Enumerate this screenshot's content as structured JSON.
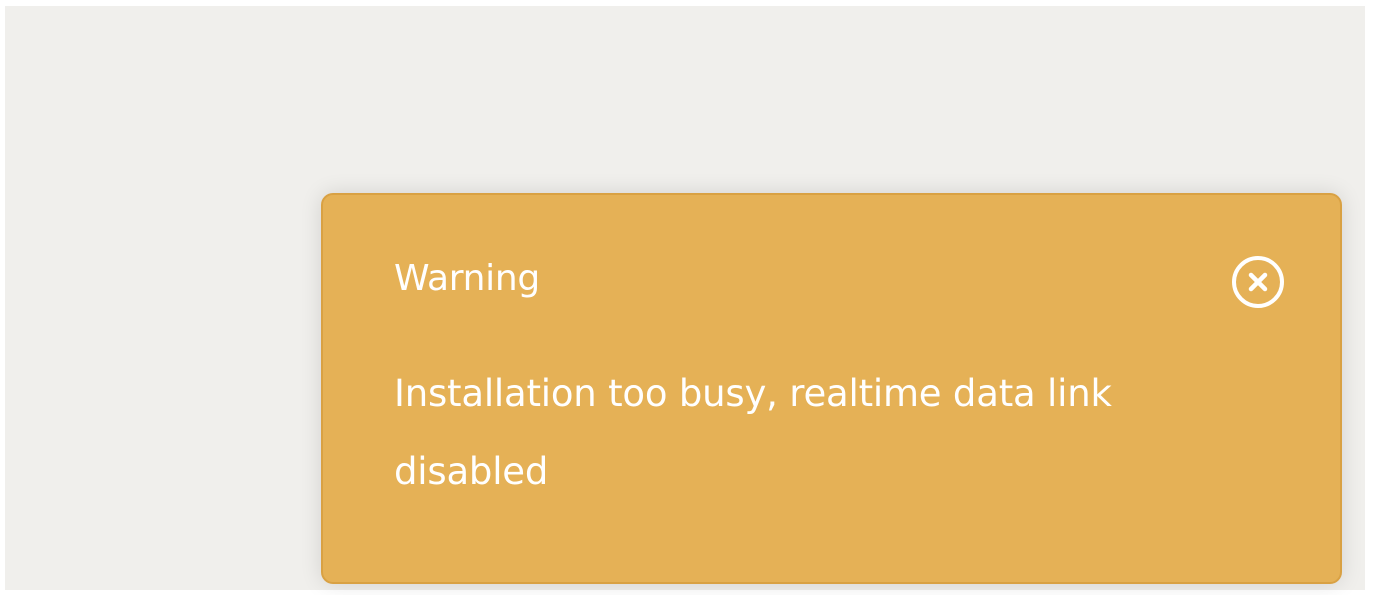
{
  "notification": {
    "type": "warning",
    "title": "Warning",
    "message": "Installation too busy, realtime data link disabled",
    "close_icon": "close-circle-icon",
    "colors": {
      "background": "#e5b156",
      "border": "#d9a143",
      "text": "#ffffff",
      "page_background": "#f0efec"
    }
  }
}
